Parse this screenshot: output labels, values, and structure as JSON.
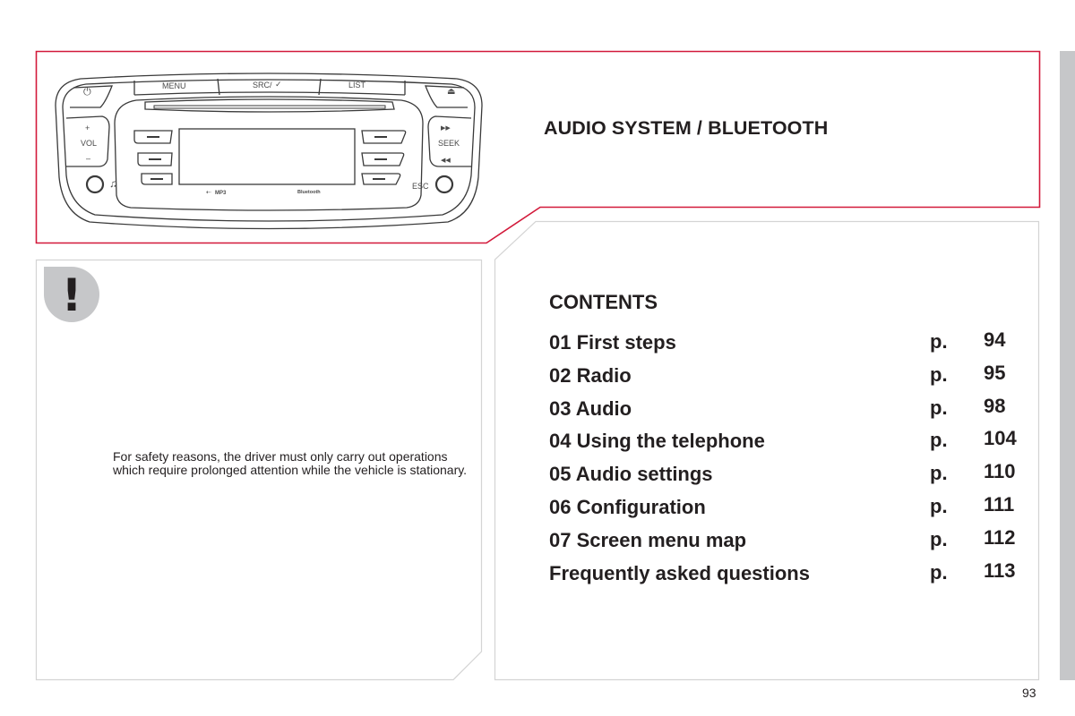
{
  "colors": {
    "accent_red": "#d2193a",
    "box_border_gray": "#d4d4d4",
    "side_tab_gray": "#c6c7c9",
    "text": "#231f20"
  },
  "header": {
    "title": "AUDIO SYSTEM / BLUETOOTH"
  },
  "radio_illustration": {
    "top_buttons": [
      "MENU",
      "SRC/",
      "LIST"
    ],
    "left_controls": {
      "power_icon": "power-icon",
      "vol_plus": "+",
      "vol_label": "VOL",
      "vol_minus": "–",
      "aux_icon": "music-note-icon"
    },
    "right_controls": {
      "eject_icon": "eject-icon",
      "seek_forward": "▶▶",
      "seek_label": "SEEK",
      "seek_back": "◀◀",
      "esc_label": "ESC"
    },
    "bottom_logos": {
      "usb_mp3": "MP3",
      "bluetooth": "Bluetooth"
    }
  },
  "warning": {
    "icon": "!",
    "text": "For safety reasons, the driver must only carry out operations which require prolonged attention while the vehicle is stationary."
  },
  "contents": {
    "heading": "CONTENTS",
    "page_prefix": "p.",
    "items": [
      {
        "title": "01 First steps",
        "page": "94"
      },
      {
        "title": "02 Radio",
        "page": "95"
      },
      {
        "title": "03 Audio",
        "page": "98"
      },
      {
        "title": "04 Using the telephone",
        "page": "104"
      },
      {
        "title": "05 Audio settings",
        "page": "110"
      },
      {
        "title": "06 Configuration",
        "page": "111"
      },
      {
        "title": "07 Screen menu map",
        "page": "112"
      },
      {
        "title": "Frequently asked questions",
        "page": "113"
      }
    ]
  },
  "footer": {
    "page_number": "93"
  }
}
